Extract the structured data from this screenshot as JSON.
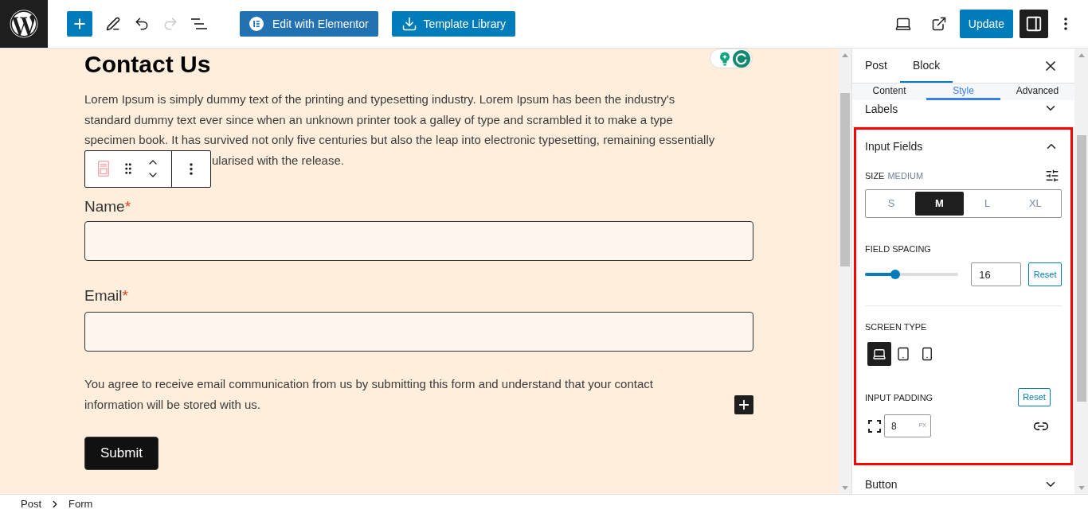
{
  "top_bar": {
    "history": [
      {
        "kind": "undo",
        "disabled": false
      },
      {
        "kind": "redo",
        "disabled": true
      }
    ],
    "actions": [
      {
        "kind": "elementor",
        "label": "Edit with Elementor"
      },
      {
        "kind": "library",
        "label": "Template Library"
      }
    ],
    "update": "Update",
    "settings_pressed": true
  },
  "editor": {
    "heading": "Contact Us",
    "intro": {
      "lines": [
        "Lorem Ipsum is simply dummy text of the printing and typesetting industry. Lorem Ipsum has been the industry's",
        "standard dummy text ever since when an unknown printer took a galley of type and scrambled it to make a type",
        "specimen book. It has survived not only five centuries but also the leap into electronic typesetting, remaining essentially"
      ],
      "tail": "ularised with the release."
    },
    "fields": [
      {
        "label": "Name",
        "mark": "*"
      },
      {
        "label": "Email",
        "mark": "*"
      }
    ],
    "consent": {
      "lines": [
        "You agree to receive email communication from us by submitting this form and understand that your contact",
        "information will be stored with us."
      ]
    },
    "submit": "Submit"
  },
  "sidebar": {
    "tabs": [
      {
        "label": "Post",
        "selected": false
      },
      {
        "label": "Block",
        "selected": true
      }
    ],
    "subtabs": [
      {
        "label": "Content",
        "selected": false
      },
      {
        "label": "Style",
        "selected": true
      },
      {
        "label": "Advanced",
        "selected": false
      }
    ],
    "sections": [
      {
        "kind": "labels",
        "title": "Labels",
        "expanded": false,
        "highlighted": false
      },
      {
        "kind": "input_fields",
        "title": "Input Fields",
        "expanded": true,
        "highlighted": true,
        "size": {
          "label": "SIZE",
          "value": "MEDIUM",
          "options": [
            {
              "label": "S",
              "selected": false
            },
            {
              "label": "M",
              "selected": true
            },
            {
              "label": "L",
              "selected": false
            },
            {
              "label": "XL",
              "selected": false
            }
          ]
        },
        "spacing": {
          "label": "FIELD SPACING",
          "level": 0.32,
          "value": "16",
          "reset": "Reset"
        },
        "screen_type": {
          "label": "SCREEN TYPE",
          "options": [
            {
              "kind": "desktop",
              "selected": true
            },
            {
              "kind": "tablet",
              "selected": false
            },
            {
              "kind": "mobile",
              "selected": false
            }
          ]
        },
        "padding": {
          "label": "INPUT PADDING",
          "reset": "Reset",
          "value": "8",
          "unit": "PX"
        }
      },
      {
        "kind": "button",
        "title": "Button",
        "expanded": false,
        "highlighted": false
      }
    ]
  },
  "breadcrumb": [
    {
      "label": "Post"
    },
    {
      "label": "Form"
    }
  ]
}
